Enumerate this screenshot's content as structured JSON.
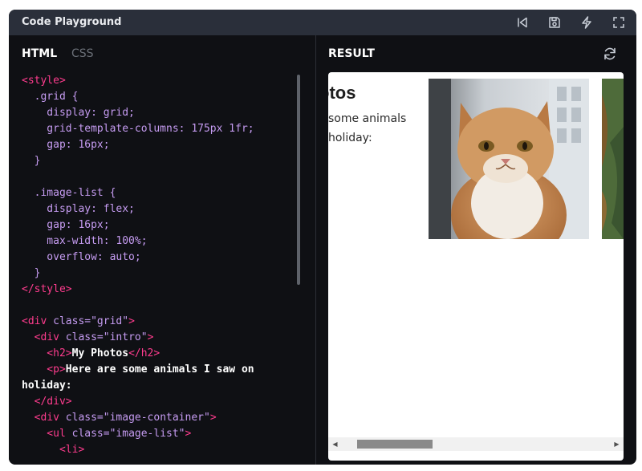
{
  "titlebar": {
    "title": "Code Playground",
    "buttons": [
      "skip-back-icon",
      "save-icon",
      "lightning-icon",
      "fullscreen-icon"
    ]
  },
  "editor": {
    "tabs": [
      {
        "label": "HTML",
        "active": true
      },
      {
        "label": "CSS",
        "active": false
      }
    ],
    "lines": [
      [
        {
          "t": "<style>",
          "c": "tag"
        }
      ],
      [
        {
          "t": "  .grid {",
          "c": "sel"
        }
      ],
      [
        {
          "t": "    display",
          "c": "prop"
        },
        {
          "t": ": grid;",
          "c": "val"
        }
      ],
      [
        {
          "t": "    grid-template-columns",
          "c": "prop"
        },
        {
          "t": ": 175px 1fr;",
          "c": "val"
        }
      ],
      [
        {
          "t": "    gap",
          "c": "prop"
        },
        {
          "t": ": 16px;",
          "c": "val"
        }
      ],
      [
        {
          "t": "  }",
          "c": "pun"
        }
      ],
      [
        {
          "t": "",
          "c": "txt"
        }
      ],
      [
        {
          "t": "  .image-list {",
          "c": "sel"
        }
      ],
      [
        {
          "t": "    display",
          "c": "prop"
        },
        {
          "t": ": flex;",
          "c": "val"
        }
      ],
      [
        {
          "t": "    gap",
          "c": "prop"
        },
        {
          "t": ": 16px;",
          "c": "val"
        }
      ],
      [
        {
          "t": "    max-width",
          "c": "prop"
        },
        {
          "t": ": 100%;",
          "c": "val"
        }
      ],
      [
        {
          "t": "    overflow",
          "c": "prop"
        },
        {
          "t": ": auto;",
          "c": "val"
        }
      ],
      [
        {
          "t": "  }",
          "c": "pun"
        }
      ],
      [
        {
          "t": "</style>",
          "c": "tag"
        }
      ],
      [
        {
          "t": "",
          "c": "txt"
        }
      ],
      [
        {
          "t": "<div ",
          "c": "tag"
        },
        {
          "t": "class=",
          "c": "attr"
        },
        {
          "t": "\"grid\"",
          "c": "str"
        },
        {
          "t": ">",
          "c": "tag"
        }
      ],
      [
        {
          "t": "  <div ",
          "c": "tag"
        },
        {
          "t": "class=",
          "c": "attr"
        },
        {
          "t": "\"intro\"",
          "c": "str"
        },
        {
          "t": ">",
          "c": "tag"
        }
      ],
      [
        {
          "t": "    <h2>",
          "c": "tag"
        },
        {
          "t": "My Photos",
          "c": "txt"
        },
        {
          "t": "</h2>",
          "c": "tag"
        }
      ],
      [
        {
          "t": "    <p>",
          "c": "tag"
        },
        {
          "t": "Here are some animals I saw on",
          "c": "txt"
        }
      ],
      [
        {
          "t": "holiday:",
          "c": "txt"
        }
      ],
      [
        {
          "t": "  </div>",
          "c": "tag"
        }
      ],
      [
        {
          "t": "  <div ",
          "c": "tag"
        },
        {
          "t": "class=",
          "c": "attr"
        },
        {
          "t": "\"image-container\"",
          "c": "str"
        },
        {
          "t": ">",
          "c": "tag"
        }
      ],
      [
        {
          "t": "    <ul ",
          "c": "tag"
        },
        {
          "t": "class=",
          "c": "attr"
        },
        {
          "t": "\"image-list\"",
          "c": "str"
        },
        {
          "t": ">",
          "c": "tag"
        }
      ],
      [
        {
          "t": "      <li>",
          "c": "tag"
        }
      ]
    ]
  },
  "result": {
    "header": "RESULT",
    "heading_visible": "otos",
    "paragraph_visible": "some animals holiday:"
  },
  "colors": {
    "background": "#0f1014",
    "titlebar": "#2a2f3a",
    "tag": "#ff3c8e",
    "keyword": "#c69cf2",
    "text": "#ffffff"
  }
}
